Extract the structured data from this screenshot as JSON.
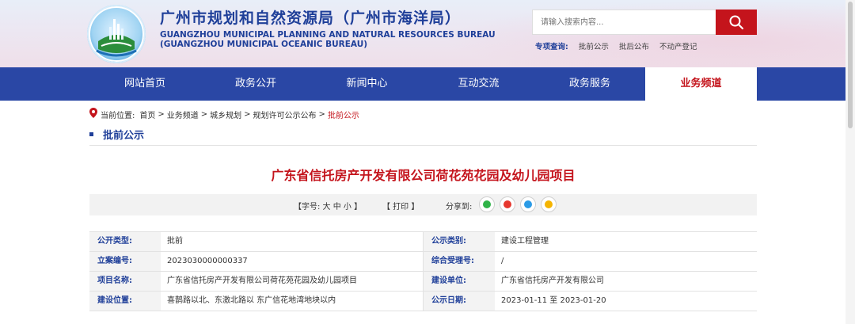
{
  "header": {
    "title_cn": "广州市规划和自然资源局（广州市海洋局）",
    "title_en_1": "GUANGZHOU MUNICIPAL PLANNING AND NATURAL RESOURCES BUREAU",
    "title_en_2": "(GUANGZHOU MUNICIPAL OCEANIC BUREAU)",
    "logo_text": "广州市规划和自然资源局"
  },
  "search": {
    "placeholder": "请输入搜索内容...",
    "button_icon": "search-icon"
  },
  "special_query": {
    "label": "专项查询:",
    "links": [
      "批前公示",
      "批后公布",
      "不动产登记"
    ]
  },
  "nav": {
    "items": [
      {
        "label": "网站首页"
      },
      {
        "label": "政务公开"
      },
      {
        "label": "新闻中心"
      },
      {
        "label": "互动交流"
      },
      {
        "label": "政务服务"
      },
      {
        "label": "业务频道"
      }
    ],
    "active_index": 5
  },
  "breadcrumb": {
    "prefix": "当前位置:",
    "items": [
      "首页",
      "业务频道",
      "城乡规划",
      "规划许可公示公布",
      "批前公示"
    ]
  },
  "section": {
    "title": "批前公示"
  },
  "document": {
    "title": "广东省信托房产开发有限公司荷花苑花园及幼儿园项目"
  },
  "toolbar": {
    "font_size_label": "【字号:  大  中  小 】",
    "print_label": "【      打印 】",
    "share_label": "分享到:",
    "share_icons": [
      "wechat-icon",
      "weibo-icon",
      "qq-icon",
      "qzone-icon"
    ]
  },
  "info": {
    "rows": [
      {
        "l1": "公开类型:",
        "v1": "批前",
        "l2": "公示类别:",
        "v2": "建设工程管理"
      },
      {
        "l1": "立案编号:",
        "v1": "2023030000000337",
        "l2": "综合受理号:",
        "v2": "/"
      },
      {
        "l1": "项目名称:",
        "v1": "广东省信托房产开发有限公司荷花苑花园及幼儿园项目",
        "l2": "建设单位:",
        "v2": "广东省信托房产开发有限公司"
      },
      {
        "l1": "建设位置:",
        "v1": "喜鹊路以北、东激北路以 东广信花地湾地块以内",
        "l2": "公示日期:",
        "v2": "2023-01-11 至 2023-01-20"
      }
    ]
  },
  "colors": {
    "brand_blue": "#1f3f99",
    "nav_blue": "#2a47a5",
    "accent_red": "#c4141c"
  }
}
